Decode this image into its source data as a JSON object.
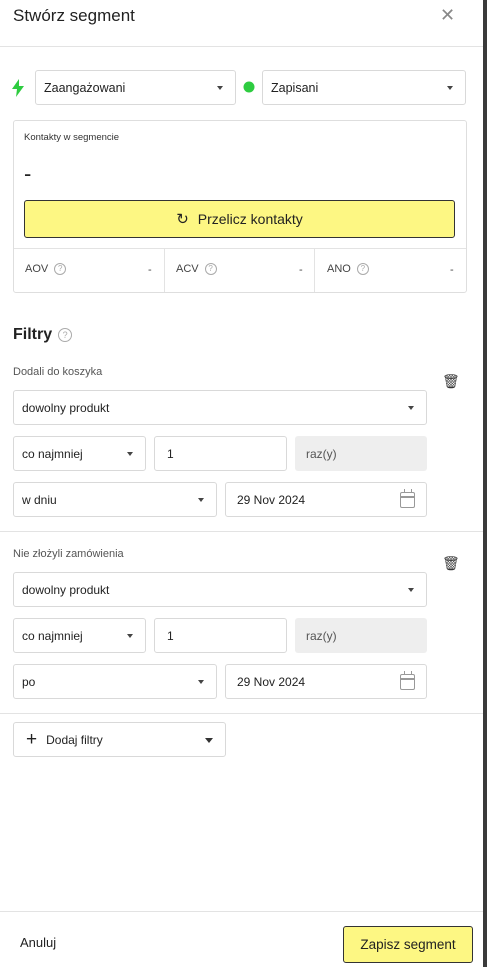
{
  "header": {
    "title": "Stwórz segment",
    "close_symbol": "✕"
  },
  "segment_selects": {
    "engagement": {
      "value": "Zaangażowani",
      "icon": "lightning-icon",
      "icon_color": "#2ecc40"
    },
    "status": {
      "value": "Zapisani",
      "icon": "green-dot-icon",
      "icon_color": "#2ecc40"
    }
  },
  "stats": {
    "label": "Kontakty w segmencie",
    "value": "-",
    "recalc_icon": "↻",
    "recalc_label": "Przelicz kontakty",
    "metrics": [
      {
        "label": "AOV",
        "value": "-"
      },
      {
        "label": "ACV",
        "value": "-"
      },
      {
        "label": "ANO",
        "value": "-"
      }
    ],
    "help_symbol": "?"
  },
  "filters": {
    "title": "Filtry",
    "groups": [
      {
        "label": "Dodali do koszyka",
        "product": "dowolny produkt",
        "quantity_mode": "co najmniej",
        "quantity": "1",
        "unit": "raz(y)",
        "date_mode": "w dniu",
        "date": "29 Nov 2024"
      },
      {
        "label": "Nie złożyli zamówienia",
        "product": "dowolny produkt",
        "quantity_mode": "co najmniej",
        "quantity": "1",
        "unit": "raz(y)",
        "date_mode": "po",
        "date": "29 Nov 2024"
      }
    ],
    "trash_symbol": "🗑",
    "add_plus": "+",
    "add_label": "Dodaj filtry"
  },
  "footer": {
    "cancel_label": "Anuluj",
    "save_label": "Zapisz segment"
  },
  "colors": {
    "accent_yellow": "#fdf783",
    "border": "#d9d9d9",
    "green": "#2ecc40"
  }
}
